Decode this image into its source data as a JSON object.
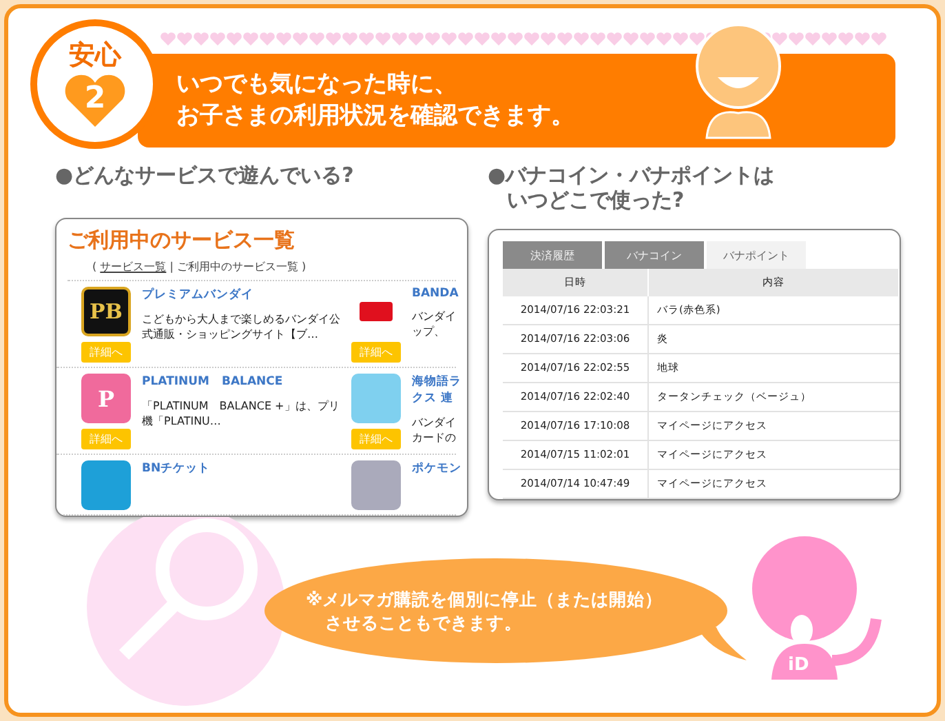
{
  "header": {
    "badge_label": "安心",
    "badge_number": "2",
    "headline": [
      "いつでも気になった時に、",
      "お子さまの利用状況を確認できます。"
    ]
  },
  "services_section": {
    "heading": "●どんなサービスで遊んでいる?",
    "panel_title": "ご利用中のサービス一覧",
    "breadcrumb": {
      "open": "(",
      "link": "サービス一覧",
      "separator": "|",
      "current": "ご利用中のサービス一覧",
      "close": ")"
    },
    "rows": [
      [
        {
          "kind": "pb",
          "logo_text": "PB",
          "name": [
            "プレミアムバンダイ"
          ],
          "description": [
            "こどもから大人まで楽しめるバンダイ公式通販・ショッピングサイト【ブ…"
          ],
          "button": "詳細へ"
        },
        {
          "kind": "red",
          "name": [
            "BANDA"
          ],
          "description": [
            "バンダイ",
            "ップ、"
          ],
          "button": "詳細へ"
        }
      ],
      [
        {
          "kind": "p",
          "logo_text": "P",
          "name": [
            "PLATINUM　BALANCE"
          ],
          "description": [
            "「PLATINUM　BALANCE +」は、プリ機「PLATINU…"
          ],
          "button": "詳細へ"
        },
        {
          "kind": "game",
          "name": [
            "海物語ラ",
            "クス 連"
          ],
          "description": [
            "バンダイ",
            "カードの"
          ],
          "button": "詳細へ"
        }
      ],
      [
        {
          "kind": "blue",
          "name": [
            "BNチケット"
          ]
        },
        {
          "kind": "gray",
          "name": [
            "ポケモン"
          ]
        }
      ]
    ]
  },
  "history_section": {
    "heading": [
      "●バナコイン・バナポイントは",
      "いつどこで使った?"
    ],
    "tabs": [
      {
        "label": "決済履歴",
        "selected": false
      },
      {
        "label": "バナコイン",
        "selected": false
      },
      {
        "label": "バナポイント",
        "selected": true
      }
    ],
    "columns": [
      "日時",
      "内容"
    ],
    "rows": [
      [
        "2014/07/16 22:03:21",
        "バラ(赤色系)"
      ],
      [
        "2014/07/16 22:03:06",
        "炎"
      ],
      [
        "2014/07/16 22:02:55",
        "地球"
      ],
      [
        "2014/07/16 22:02:40",
        "タータンチェック（ベージュ）"
      ],
      [
        "2014/07/16 17:10:08",
        "マイページにアクセス"
      ],
      [
        "2014/07/15 11:02:01",
        "マイページにアクセス"
      ],
      [
        "2014/07/14 10:47:49",
        "マイページにアクセス"
      ]
    ]
  },
  "note": {
    "lines": [
      "※メルマガ購読を個別に停止（または開始）",
      "させることもできます。"
    ]
  },
  "mascot": {
    "shirt_text": "iD"
  }
}
